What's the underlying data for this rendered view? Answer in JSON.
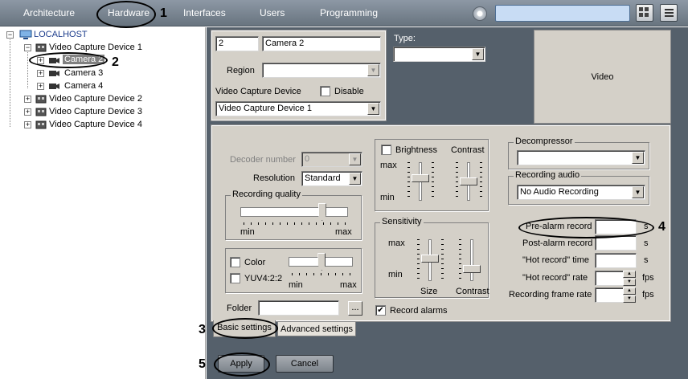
{
  "nav": {
    "items": [
      "Architecture",
      "Hardware",
      "Interfaces",
      "Users",
      "Programming"
    ],
    "search_value": ""
  },
  "tree": {
    "root": "LOCALHOST",
    "device1": "Video Capture Device 1",
    "cameras": [
      "Camera 2",
      "Camera 3",
      "Camera 4"
    ],
    "devices_rest": [
      "Video Capture Device 2",
      "Video Capture Device 3",
      "Video Capture Device 4"
    ]
  },
  "object": {
    "id": "2",
    "name": "Camera 2",
    "type_label": "Type:",
    "type_value": "",
    "region_label": "Region",
    "region_value": "",
    "vcd_label": "Video Capture Device",
    "disable_label": "Disable",
    "vcd_value": "Video Capture Device 1",
    "video_label": "Video"
  },
  "basic": {
    "decoder_label": "Decoder number",
    "decoder_value": "0",
    "resolution_label": "Resolution",
    "resolution_value": "Standard",
    "rec_quality_label": "Recording quality",
    "rec_quality_level": 0.78,
    "min": "min",
    "max": "max",
    "color_label": "Color",
    "color_level": 0.52,
    "yuv_label": "YUV4:2:2",
    "folder_label": "Folder",
    "folder_value": "",
    "browse_label": "...",
    "brightness_label": "Brightness",
    "contrast_label": "Contrast",
    "brightness_level": 0.6,
    "contrast_level": 0.5,
    "sensitivity_label": "Sensitivity",
    "size_label": "Size",
    "sens_size_level": 0.55,
    "sens_contrast_level": 0.25,
    "record_alarms_label": "Record alarms",
    "record_alarms_check": "✔",
    "decompressor_label": "Decompressor",
    "decompressor_value": "",
    "rec_audio_label": "Recording audio",
    "rec_audio_value": "No Audio Recording",
    "pre_alarm_label": "Pre-alarm record",
    "post_alarm_label": "Post-alarm record",
    "hot_time_label": "\"Hot record\" time",
    "hot_rate_label": "\"Hot record\" rate",
    "rec_frame_rate_label": "Recording frame rate",
    "unit_s": "s",
    "unit_fps": "fps",
    "pre_alarm_value": "",
    "post_alarm_value": "",
    "hot_time_value": "",
    "hot_rate_value": "",
    "rec_frame_rate_value": ""
  },
  "tabs": [
    "Basic settings",
    "Advanced settings"
  ],
  "footer": {
    "apply": "Apply",
    "cancel": "Cancel"
  },
  "annotations": [
    "1",
    "2",
    "3",
    "4",
    "5"
  ]
}
